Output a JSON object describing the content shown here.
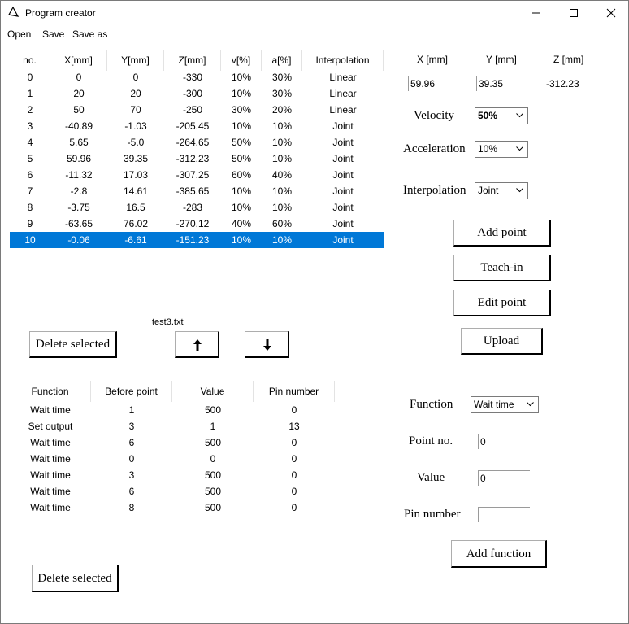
{
  "window": {
    "title": "Program creator"
  },
  "menu": [
    "Open",
    "Save",
    "Save as"
  ],
  "points_table": {
    "columns": [
      "no.",
      "X[mm]",
      "Y[mm]",
      "Z[mm]",
      "v[%]",
      "a[%]",
      "Interpolation"
    ],
    "rows": [
      [
        "0",
        "0",
        "0",
        "-330",
        "10%",
        "30%",
        "Linear"
      ],
      [
        "1",
        "20",
        "20",
        "-300",
        "10%",
        "30%",
        "Linear"
      ],
      [
        "2",
        "50",
        "70",
        "-250",
        "30%",
        "20%",
        "Linear"
      ],
      [
        "3",
        "-40.89",
        "-1.03",
        "-205.45",
        "10%",
        "10%",
        "Joint"
      ],
      [
        "4",
        "5.65",
        "-5.0",
        "-264.65",
        "50%",
        "10%",
        "Joint"
      ],
      [
        "5",
        "59.96",
        "39.35",
        "-312.23",
        "50%",
        "10%",
        "Joint"
      ],
      [
        "6",
        "-11.32",
        "17.03",
        "-307.25",
        "60%",
        "40%",
        "Joint"
      ],
      [
        "7",
        "-2.8",
        "14.61",
        "-385.65",
        "10%",
        "10%",
        "Joint"
      ],
      [
        "8",
        "-3.75",
        "16.5",
        "-283",
        "10%",
        "10%",
        "Joint"
      ],
      [
        "9",
        "-63.65",
        "76.02",
        "-270.12",
        "40%",
        "60%",
        "Joint"
      ],
      [
        "10",
        "-0.06",
        "-6.61",
        "-151.23",
        "10%",
        "10%",
        "Joint"
      ]
    ],
    "selected_row": 10
  },
  "coords": {
    "x_label": "X [mm]",
    "y_label": "Y [mm]",
    "z_label": "Z [mm]",
    "x_value": "59.96",
    "y_value": "39.35",
    "z_value": "-312.23"
  },
  "motion": {
    "velocity_label": "Velocity",
    "velocity_value": "50%",
    "acceleration_label": "Acceleration",
    "acceleration_value": "10%",
    "interpolation_label": "Interpolation",
    "interpolation_value": "Joint"
  },
  "point_buttons": {
    "add": "Add point",
    "teach": "Teach-in",
    "edit": "Edit point",
    "upload": "Upload"
  },
  "filename": "test3.txt",
  "delete_points_label": "Delete selected",
  "functions_table": {
    "columns": [
      "Function",
      "Before point",
      "Value",
      "Pin number"
    ],
    "rows": [
      [
        "Wait time",
        "1",
        "500",
        "0"
      ],
      [
        "Set output",
        "3",
        "1",
        "13"
      ],
      [
        "Wait time",
        "6",
        "500",
        "0"
      ],
      [
        "Wait time",
        "0",
        "0",
        "0"
      ],
      [
        "Wait time",
        "3",
        "500",
        "0"
      ],
      [
        "Wait time",
        "6",
        "500",
        "0"
      ],
      [
        "Wait time",
        "8",
        "500",
        "0"
      ]
    ]
  },
  "function_form": {
    "function_label": "Function",
    "function_value": "Wait time",
    "point_label": "Point no.",
    "point_value": "0",
    "value_label": "Value",
    "value_value": "0",
    "pin_label": "Pin number",
    "pin_value": "",
    "add_label": "Add function"
  },
  "delete_functions_label": "Delete selected",
  "colors": {
    "selection": "#0078d7"
  }
}
